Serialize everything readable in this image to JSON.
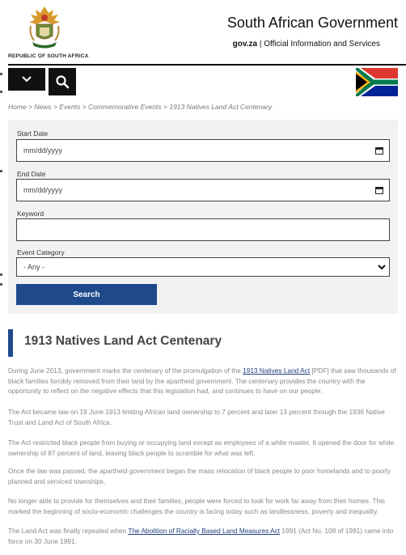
{
  "header": {
    "country_label": "REPUBLIC OF SOUTH AFRICA",
    "site_title": "South African Government",
    "domain": "gov.za",
    "separator": "|",
    "tagline": "Official Information and Services"
  },
  "breadcrumb": {
    "text": "Home > News > Events > Commemorative Events > 1913 Natives Land Act Centenary"
  },
  "form": {
    "start_date_label": "Start Date",
    "start_date_value": "mm/dd/yyyy",
    "end_date_label": "End Date",
    "end_date_value": "mm/dd/yyyy",
    "keyword_label": "Keyword",
    "keyword_value": "",
    "category_label": "Event Category",
    "category_value": "- Any -",
    "search_label": "Search"
  },
  "article": {
    "title": "1913 Natives Land Act Centenary",
    "p1_a": "During June 2013, government marks the centenary of the promulgation of the ",
    "p1_link": "1913 Natives Land Act",
    "p1_b": " [PDF] that saw thousands of black families forcibly removed from their land by the apartheid government. The centenary provides the country with the opportunity to reflect on the negative effects that this legislation had, and continues to have on our people.",
    "p2": "The Act became law on 19 June 1913 limiting African land ownership to 7 percent and later 13 percent through the 1936 Native Trust and Land Act of South Africa.",
    "p3": "The Act restricted black people from buying or occupying land except as employees of a white master. It opened the door for white ownership of 87 percent of land, leaving black people to scramble for what was left.",
    "p4": "Once the law was passed, the apartheid government began the mass relocation of black people to poor homelands and to poorly planned and serviced townships.",
    "p5": "No longer able to provide for themselves and their families, people were forced to look for work far away from their homes. This marked the beginning of socio-economic challenges the country is facing today such as landlessness, poverty and inequality.",
    "p6_a": "The Land Act was finally repealed when ",
    "p6_link": "The Abolition of Racially Based Land Measures Act",
    "p6_b": " 1991 (Act No. 108 of 1991) came into force on 30 June 1991."
  },
  "colors": {
    "accent_blue": "#1e4a8c",
    "nav_black": "#111111",
    "form_bg": "#f2f2f2"
  }
}
